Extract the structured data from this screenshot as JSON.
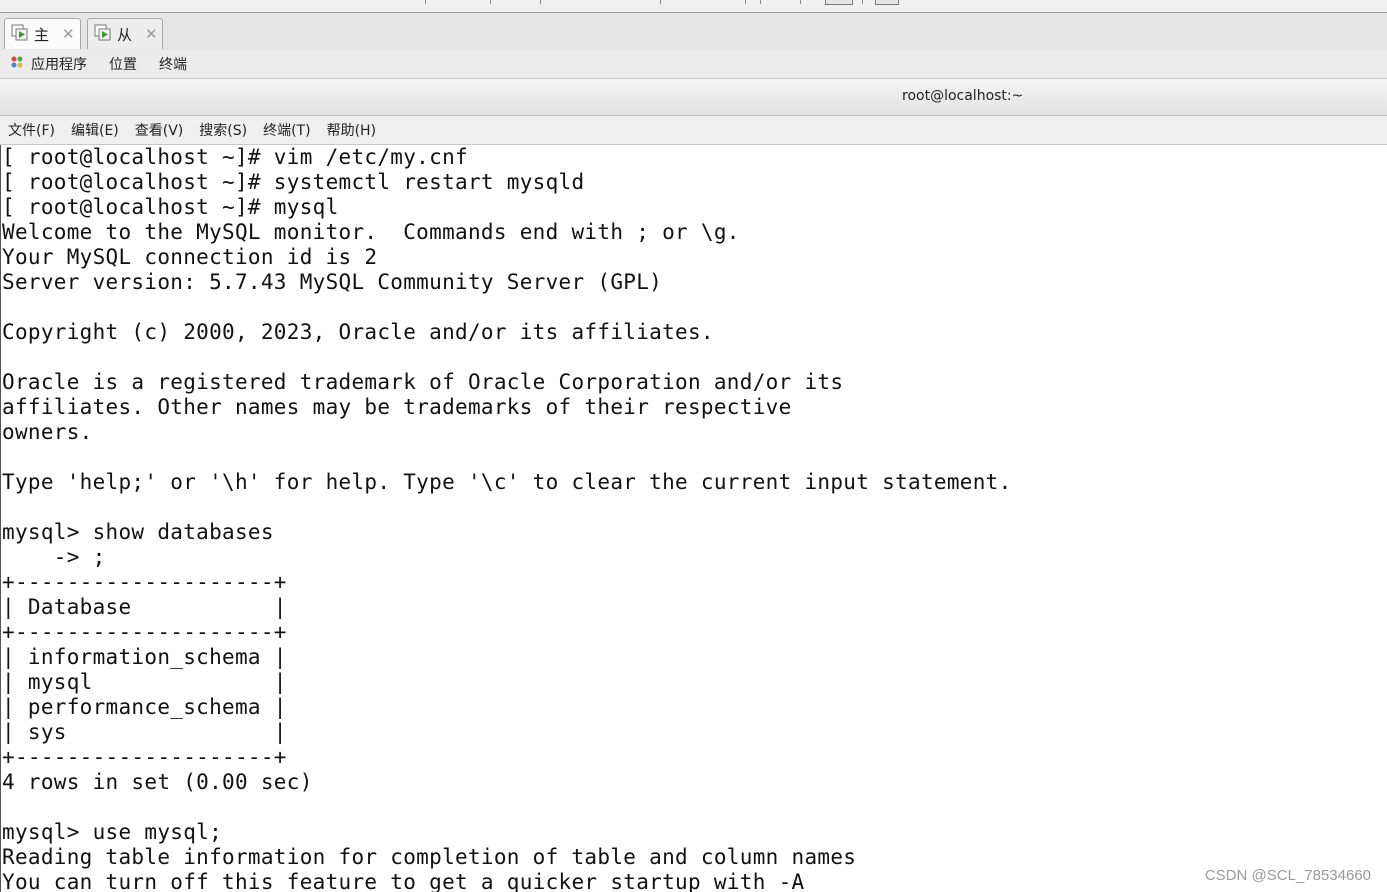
{
  "tabs": [
    {
      "label": "主"
    },
    {
      "label": "从"
    }
  ],
  "top_menu": {
    "applications": "应用程序",
    "places": "位置",
    "terminal": "终端"
  },
  "window": {
    "title": "root@localhost:~"
  },
  "terminal_menu": [
    {
      "label": "文件(F)"
    },
    {
      "label": "编辑(E)"
    },
    {
      "label": "查看(V)"
    },
    {
      "label": "搜索(S)"
    },
    {
      "label": "终端(T)"
    },
    {
      "label": "帮助(H)"
    }
  ],
  "terminal_lines": [
    "[ root@localhost ~]# vim /etc/my.cnf",
    "[ root@localhost ~]# systemctl restart mysqld",
    "[ root@localhost ~]# mysql",
    "Welcome to the MySQL monitor.  Commands end with ; or \\g.",
    "Your MySQL connection id is 2",
    "Server version: 5.7.43 MySQL Community Server (GPL)",
    "",
    "Copyright (c) 2000, 2023, Oracle and/or its affiliates.",
    "",
    "Oracle is a registered trademark of Oracle Corporation and/or its",
    "affiliates. Other names may be trademarks of their respective",
    "owners.",
    "",
    "Type 'help;' or '\\h' for help. Type '\\c' to clear the current input statement.",
    "",
    "mysql> show databases",
    "    -> ;",
    "+--------------------+",
    "| Database           |",
    "+--------------------+",
    "| information_schema |",
    "| mysql              |",
    "| performance_schema |",
    "| sys                |",
    "+--------------------+",
    "4 rows in set (0.00 sec)",
    "",
    "mysql> use mysql;",
    "Reading table information for completion of table and column names",
    "You can turn off this feature to get a quicker startup with -A"
  ],
  "watermark": "CSDN @SCL_78534660",
  "colors": {
    "terminal_bg": "#ffffff",
    "terminal_fg": "#111111",
    "chrome_bg": "#ececec"
  }
}
